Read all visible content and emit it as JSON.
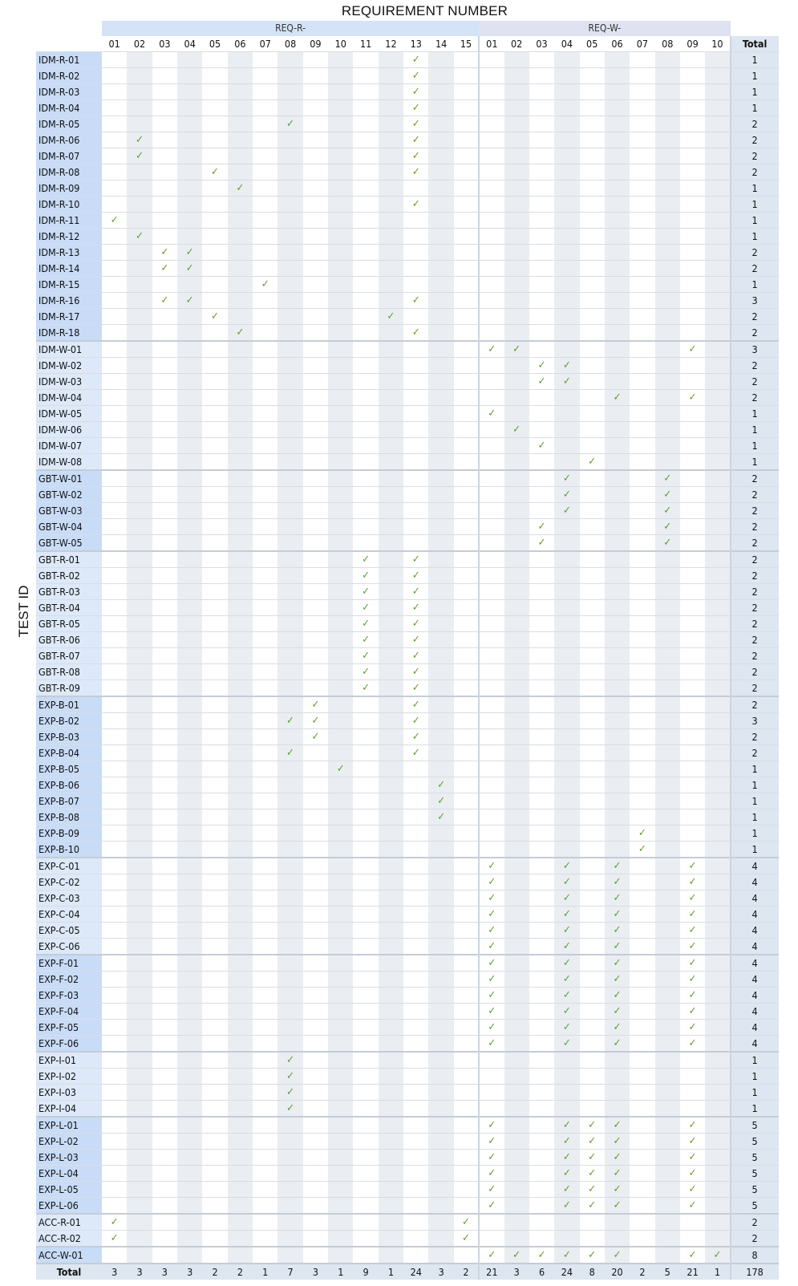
{
  "title": "REQUIREMENT NUMBER",
  "y_label": "TEST ID",
  "group_r_label": "REQ-R-",
  "group_w_label": "REQ-W-",
  "r_cols": [
    "01",
    "02",
    "03",
    "04",
    "05",
    "06",
    "07",
    "08",
    "09",
    "10",
    "11",
    "12",
    "13",
    "14",
    "15"
  ],
  "w_cols": [
    "01",
    "02",
    "03",
    "04",
    "05",
    "06",
    "07",
    "08",
    "09",
    "10"
  ],
  "total_label": "Total",
  "check_glyph": "✓",
  "check_color": "#5c9e2c",
  "groups": [
    {
      "rows": [
        {
          "id": "IDM-R-01",
          "r": [
            13
          ],
          "w": [],
          "total": "1"
        },
        {
          "id": "IDM-R-02",
          "r": [
            13
          ],
          "w": [],
          "total": "1"
        },
        {
          "id": "IDM-R-03",
          "r": [
            13
          ],
          "w": [],
          "total": "1"
        },
        {
          "id": "IDM-R-04",
          "r": [
            13
          ],
          "w": [],
          "total": "1"
        },
        {
          "id": "IDM-R-05",
          "r": [
            8,
            13
          ],
          "w": [],
          "total": "2"
        },
        {
          "id": "IDM-R-06",
          "r": [
            2,
            13
          ],
          "w": [],
          "total": "2"
        },
        {
          "id": "IDM-R-07",
          "r": [
            2,
            13
          ],
          "w": [],
          "total": "2"
        },
        {
          "id": "IDM-R-08",
          "r": [
            5,
            13
          ],
          "w": [],
          "total": "2"
        },
        {
          "id": "IDM-R-09",
          "r": [
            6
          ],
          "w": [],
          "total": "1"
        },
        {
          "id": "IDM-R-10",
          "r": [
            13
          ],
          "w": [],
          "total": "1"
        },
        {
          "id": "IDM-R-11",
          "r": [
            1
          ],
          "w": [],
          "total": "1"
        },
        {
          "id": "IDM-R-12",
          "r": [
            2
          ],
          "w": [],
          "total": "1"
        },
        {
          "id": "IDM-R-13",
          "r": [
            3,
            4
          ],
          "w": [],
          "total": "2"
        },
        {
          "id": "IDM-R-14",
          "r": [
            3,
            4
          ],
          "w": [],
          "total": "2"
        },
        {
          "id": "IDM-R-15",
          "r": [
            7
          ],
          "w": [],
          "total": "1"
        },
        {
          "id": "IDM-R-16",
          "r": [
            3,
            4,
            13
          ],
          "w": [],
          "total": "3"
        },
        {
          "id": "IDM-R-17",
          "r": [
            5,
            12
          ],
          "w": [],
          "total": "2"
        },
        {
          "id": "IDM-R-18",
          "r": [
            6,
            13
          ],
          "w": [],
          "total": "2"
        }
      ]
    },
    {
      "rows": [
        {
          "id": "IDM-W-01",
          "r": [],
          "w": [
            1,
            2,
            9
          ],
          "total": "3"
        },
        {
          "id": "IDM-W-02",
          "r": [],
          "w": [
            3,
            4
          ],
          "total": "2"
        },
        {
          "id": "IDM-W-03",
          "r": [],
          "w": [
            3,
            4
          ],
          "total": "2"
        },
        {
          "id": "IDM-W-04",
          "r": [],
          "w": [
            6,
            9
          ],
          "total": "2"
        },
        {
          "id": "IDM-W-05",
          "r": [],
          "w": [
            1
          ],
          "total": "1"
        },
        {
          "id": "IDM-W-06",
          "r": [],
          "w": [
            2
          ],
          "total": "1"
        },
        {
          "id": "IDM-W-07",
          "r": [],
          "w": [
            3
          ],
          "total": "1"
        },
        {
          "id": "IDM-W-08",
          "r": [],
          "w": [
            5
          ],
          "total": "1"
        }
      ]
    },
    {
      "rows": [
        {
          "id": "GBT-W-01",
          "r": [],
          "w": [
            4,
            8
          ],
          "total": "2"
        },
        {
          "id": "GBT-W-02",
          "r": [],
          "w": [
            4,
            8
          ],
          "total": "2"
        },
        {
          "id": "GBT-W-03",
          "r": [],
          "w": [
            4,
            8
          ],
          "total": "2"
        },
        {
          "id": "GBT-W-04",
          "r": [],
          "w": [
            3,
            8
          ],
          "total": "2"
        },
        {
          "id": "GBT-W-05",
          "r": [],
          "w": [
            3,
            8
          ],
          "total": "2"
        }
      ]
    },
    {
      "rows": [
        {
          "id": "GBT-R-01",
          "r": [
            11,
            13
          ],
          "w": [],
          "total": "2"
        },
        {
          "id": "GBT-R-02",
          "r": [
            11,
            13
          ],
          "w": [],
          "total": "2"
        },
        {
          "id": "GBT-R-03",
          "r": [
            11,
            13
          ],
          "w": [],
          "total": "2"
        },
        {
          "id": "GBT-R-04",
          "r": [
            11,
            13
          ],
          "w": [],
          "total": "2"
        },
        {
          "id": "GBT-R-05",
          "r": [
            11,
            13
          ],
          "w": [],
          "total": "2"
        },
        {
          "id": "GBT-R-06",
          "r": [
            11,
            13
          ],
          "w": [],
          "total": "2"
        },
        {
          "id": "GBT-R-07",
          "r": [
            11,
            13
          ],
          "w": [],
          "total": "2"
        },
        {
          "id": "GBT-R-08",
          "r": [
            11,
            13
          ],
          "w": [],
          "total": "2"
        },
        {
          "id": "GBT-R-09",
          "r": [
            11,
            13
          ],
          "w": [],
          "total": "2"
        }
      ]
    },
    {
      "rows": [
        {
          "id": "EXP-B-01",
          "r": [
            9,
            13
          ],
          "w": [],
          "total": "2"
        },
        {
          "id": "EXP-B-02",
          "r": [
            8,
            9,
            13
          ],
          "w": [],
          "total": "3"
        },
        {
          "id": "EXP-B-03",
          "r": [
            9,
            13
          ],
          "w": [],
          "total": "2"
        },
        {
          "id": "EXP-B-04",
          "r": [
            8,
            13
          ],
          "w": [],
          "total": "2"
        },
        {
          "id": "EXP-B-05",
          "r": [
            10
          ],
          "w": [],
          "total": "1"
        },
        {
          "id": "EXP-B-06",
          "r": [
            14
          ],
          "w": [],
          "total": "1"
        },
        {
          "id": "EXP-B-07",
          "r": [
            14
          ],
          "w": [],
          "total": "1"
        },
        {
          "id": "EXP-B-08",
          "r": [
            14
          ],
          "w": [],
          "total": "1"
        },
        {
          "id": "EXP-B-09",
          "r": [],
          "w": [
            7
          ],
          "total": "1"
        },
        {
          "id": "EXP-B-10",
          "r": [],
          "w": [
            7
          ],
          "total": "1"
        }
      ]
    },
    {
      "rows": [
        {
          "id": "EXP-C-01",
          "r": [],
          "w": [
            1,
            4,
            6,
            9
          ],
          "total": "4"
        },
        {
          "id": "EXP-C-02",
          "r": [],
          "w": [
            1,
            4,
            6,
            9
          ],
          "total": "4"
        },
        {
          "id": "EXP-C-03",
          "r": [],
          "w": [
            1,
            4,
            6,
            9
          ],
          "total": "4"
        },
        {
          "id": "EXP-C-04",
          "r": [],
          "w": [
            1,
            4,
            6,
            9
          ],
          "total": "4"
        },
        {
          "id": "EXP-C-05",
          "r": [],
          "w": [
            1,
            4,
            6,
            9
          ],
          "total": "4"
        },
        {
          "id": "EXP-C-06",
          "r": [],
          "w": [
            1,
            4,
            6,
            9
          ],
          "total": "4"
        }
      ]
    },
    {
      "rows": [
        {
          "id": "EXP-F-01",
          "r": [],
          "w": [
            1,
            4,
            6,
            9
          ],
          "total": "4"
        },
        {
          "id": "EXP-F-02",
          "r": [],
          "w": [
            1,
            4,
            6,
            9
          ],
          "total": "4"
        },
        {
          "id": "EXP-F-03",
          "r": [],
          "w": [
            1,
            4,
            6,
            9
          ],
          "total": "4"
        },
        {
          "id": "EXP-F-04",
          "r": [],
          "w": [
            1,
            4,
            6,
            9
          ],
          "total": "4"
        },
        {
          "id": "EXP-F-05",
          "r": [],
          "w": [
            1,
            4,
            6,
            9
          ],
          "total": "4"
        },
        {
          "id": "EXP-F-06",
          "r": [],
          "w": [
            1,
            4,
            6,
            9
          ],
          "total": "4"
        }
      ]
    },
    {
      "rows": [
        {
          "id": "EXP-I-01",
          "r": [
            8
          ],
          "w": [],
          "total": "1"
        },
        {
          "id": "EXP-I-02",
          "r": [
            8
          ],
          "w": [],
          "total": "1"
        },
        {
          "id": "EXP-I-03",
          "r": [
            8
          ],
          "w": [],
          "total": "1"
        },
        {
          "id": "EXP-I-04",
          "r": [
            8
          ],
          "w": [],
          "total": "1"
        }
      ]
    },
    {
      "rows": [
        {
          "id": "EXP-L-01",
          "r": [],
          "w": [
            1,
            4,
            5,
            6,
            9
          ],
          "total": "5"
        },
        {
          "id": "EXP-L-02",
          "r": [],
          "w": [
            1,
            4,
            5,
            6,
            9
          ],
          "total": "5"
        },
        {
          "id": "EXP-L-03",
          "r": [],
          "w": [
            1,
            4,
            5,
            6,
            9
          ],
          "total": "5"
        },
        {
          "id": "EXP-L-04",
          "r": [],
          "w": [
            1,
            4,
            5,
            6,
            9
          ],
          "total": "5"
        },
        {
          "id": "EXP-L-05",
          "r": [],
          "w": [
            1,
            4,
            5,
            6,
            9
          ],
          "total": "5"
        },
        {
          "id": "EXP-L-06",
          "r": [],
          "w": [
            1,
            4,
            5,
            6,
            9
          ],
          "total": "5"
        }
      ]
    },
    {
      "rows": [
        {
          "id": "ACC-R-01",
          "r": [
            1,
            15
          ],
          "w": [],
          "total": "2"
        },
        {
          "id": "ACC-R-02",
          "r": [
            1,
            15
          ],
          "w": [],
          "total": "2"
        }
      ]
    },
    {
      "rows": [
        {
          "id": "ACC-W-01",
          "r": [],
          "w": [
            1,
            2,
            3,
            4,
            5,
            6,
            9,
            10
          ],
          "total": "8"
        }
      ]
    }
  ],
  "totals": {
    "r": [
      "3",
      "3",
      "3",
      "3",
      "2",
      "2",
      "1",
      "7",
      "3",
      "1",
      "9",
      "1",
      "24",
      "3",
      "2"
    ],
    "w": [
      "21",
      "3",
      "6",
      "24",
      "8",
      "20",
      "2",
      "5",
      "21",
      "1"
    ],
    "grand": "178"
  }
}
